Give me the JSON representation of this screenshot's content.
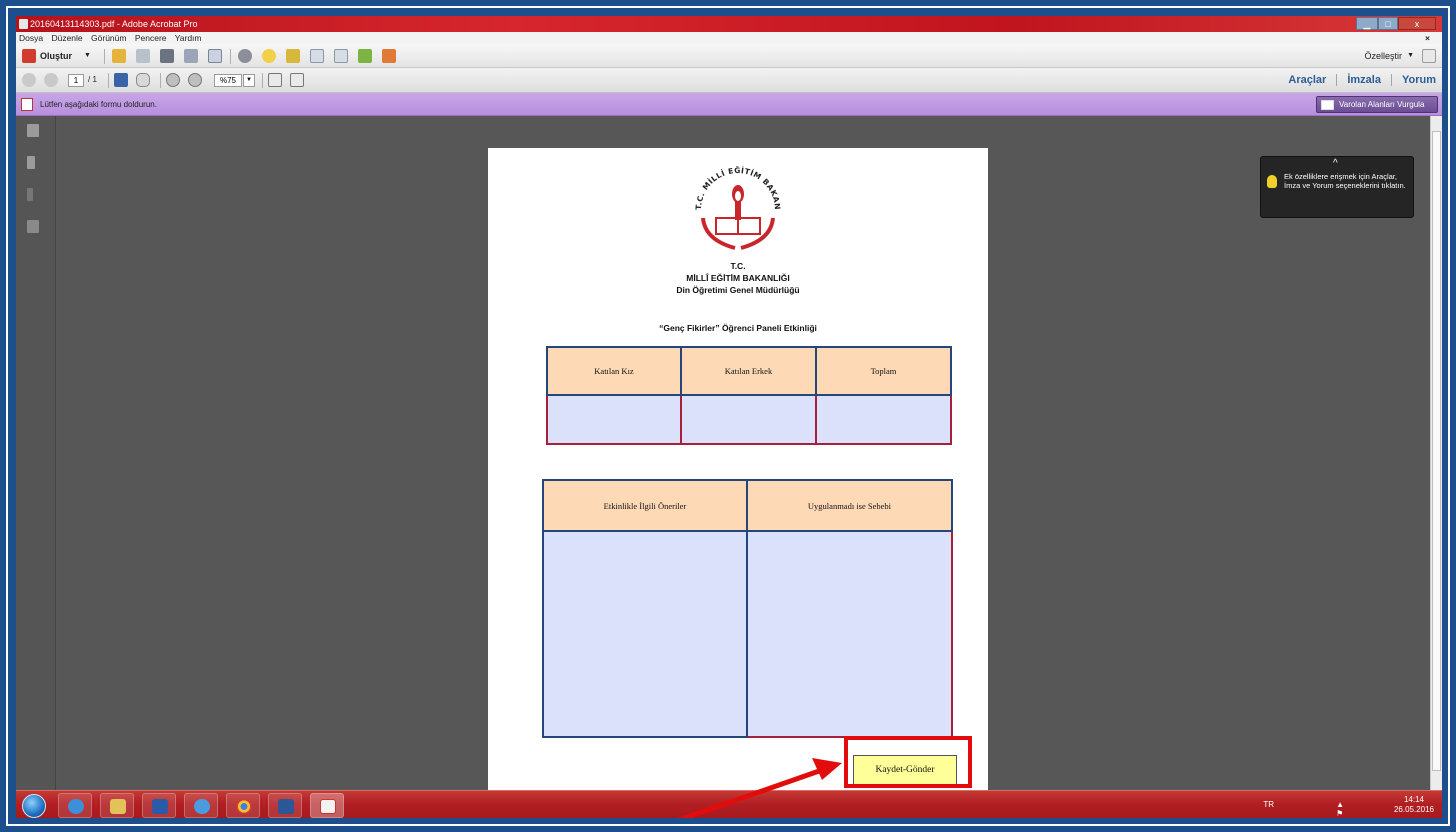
{
  "window": {
    "title": "20160413114303.pdf - Adobe Acrobat Pro",
    "min_glyph": "▁",
    "max_glyph": "□",
    "close_glyph": "x"
  },
  "menu": {
    "items": [
      "Dosya",
      "Düzenle",
      "Görünüm",
      "Pencere",
      "Yardım"
    ],
    "doc_close": "×"
  },
  "toolbar": {
    "create_label": "Oluştur",
    "customize_label": "Özelleştir",
    "page_current": "1",
    "page_total": "/ 1",
    "zoom": "%75"
  },
  "right_links": {
    "tools": "Araçlar",
    "sign": "İmzala",
    "comment": "Yorum"
  },
  "form_bar": {
    "message": "Lütfen aşağıdaki formu doldurun.",
    "highlight_button": "Varolan Alanları Vurgula"
  },
  "tooltip": {
    "text": "Ek özelliklere erişmek için Araçlar, İmza ve Yorum seçeneklerini tıklatın."
  },
  "document": {
    "header_line1": "T.C.",
    "header_line2": "MİLLÎ EĞİTİM BAKANLIĞI",
    "header_line3": "Din Öğretimi Genel Müdürlüğü",
    "logo_text": "T.C. MİLLİ EĞİTİM BAKANLIĞI",
    "form_title": "“Genç Fikirler” Öğrenci Paneli Etkinliği",
    "table1_headers": [
      "Katılan Kız",
      "Katılan Erkek",
      "Toplam"
    ],
    "table2_headers": [
      "Etkinlikle İlgili Öneriler",
      "Uygulanmadı ise Sebebi"
    ],
    "submit_button": "Kaydet-Gönder"
  },
  "taskbar": {
    "language": "TR",
    "time": "14:14",
    "date": "26.05.2016"
  },
  "colors": {
    "title_bar": "#c0141e",
    "form_bar": "#c8a6e8",
    "table_header": "#fdd9b5",
    "table_cell": "#dbe1fb",
    "submit_bg": "#ffff99",
    "callout_red": "#e20c0c"
  }
}
